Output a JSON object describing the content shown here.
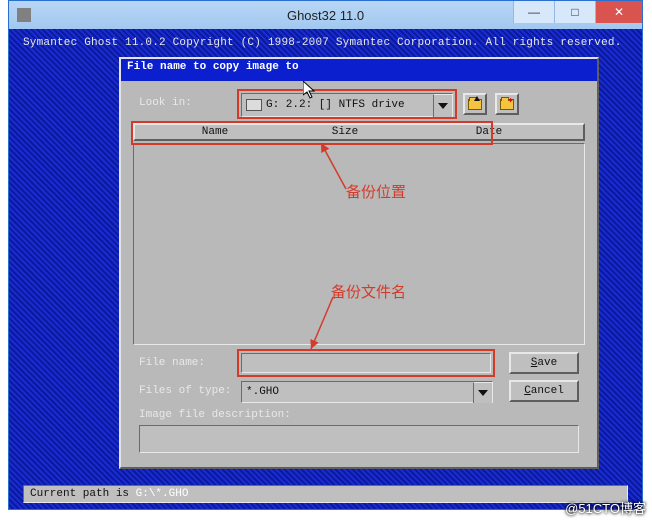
{
  "window": {
    "title": "Ghost32 11.0",
    "min_label": "—",
    "max_label": "□",
    "close_label": "✕"
  },
  "ghost": {
    "copyright": "Symantec Ghost 11.0.2   Copyright (C) 1998-2007 Symantec Corporation. All rights reserved."
  },
  "dialog": {
    "title": "File name to copy image to",
    "lookin_label": "Look in:",
    "lookin_value": "G: 2.2: [] NTFS drive",
    "col_name": "Name",
    "col_size": "Size",
    "col_date": "Date",
    "filename_label": "File name:",
    "filename_value": "",
    "filetype_label": "Files of type:",
    "filetype_value": "*.GHO",
    "desc_label": "Image file description:",
    "desc_value": "",
    "save_label": "Save",
    "cancel_label": "Cancel"
  },
  "status": {
    "prefix": "Current path is ",
    "path": "G:\\*.GHO"
  },
  "annotations": {
    "location": "备份位置",
    "filename": "备份文件名"
  },
  "watermark": "@51CTO博客"
}
